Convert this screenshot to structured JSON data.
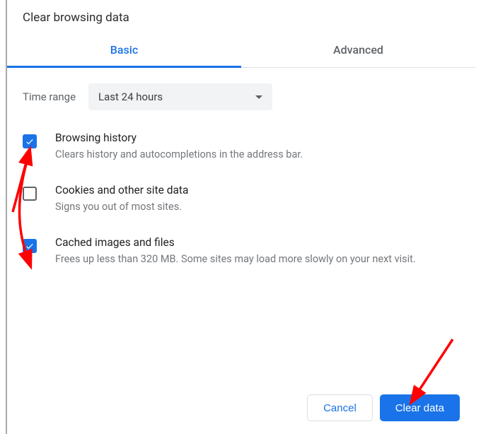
{
  "dialog": {
    "title": "Clear browsing data",
    "tabs": {
      "basic": "Basic",
      "advanced": "Advanced"
    },
    "timerange": {
      "label": "Time range",
      "selected": "Last 24 hours"
    },
    "options": [
      {
        "title": "Browsing history",
        "desc": "Clears history and autocompletions in the address bar.",
        "checked": true
      },
      {
        "title": "Cookies and other site data",
        "desc": "Signs you out of most sites.",
        "checked": false
      },
      {
        "title": "Cached images and files",
        "desc": "Frees up less than 320 MB. Some sites may load more slowly on your next visit.",
        "checked": true
      }
    ],
    "buttons": {
      "cancel": "Cancel",
      "clear": "Clear data"
    }
  },
  "colors": {
    "accent": "#1a73e8",
    "arrow": "#ff0000"
  }
}
